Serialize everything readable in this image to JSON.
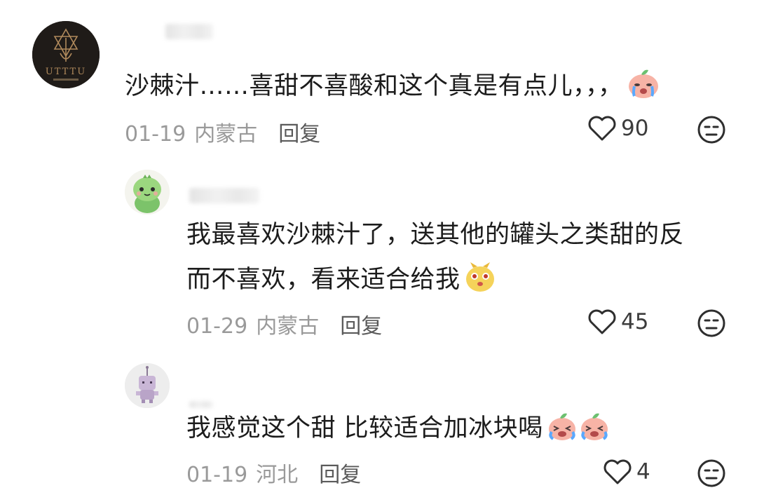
{
  "comments": [
    {
      "text": "沙棘汁……喜甜不喜酸和这个真是有点儿，，，",
      "date": "01-19",
      "region": "内蒙古",
      "reply_label": "回复",
      "likes": "90",
      "avatar": "logo-avatar"
    },
    {
      "text_line1": "我最喜欢沙棘汁了，送其他的罐头之类甜的反",
      "text_line2": "而不喜欢，看来适合给我",
      "date": "01-29",
      "region": "内蒙古",
      "reply_label": "回复",
      "likes": "45",
      "avatar": "green-dinosaur-avatar"
    },
    {
      "text": "我感觉这个甜 比较适合加冰块喝",
      "date": "01-19",
      "region": "河北",
      "reply_label": "回复",
      "likes": "4",
      "avatar": "purple-character-avatar"
    }
  ],
  "avatar1_logo_text": "UTTTU",
  "icons": {
    "like": "heart-outline-icon",
    "dislike": "neutral-face-icon",
    "emoji_crying": "crying-peach-emoji",
    "emoji_cute": "cute-yellow-emoji"
  }
}
